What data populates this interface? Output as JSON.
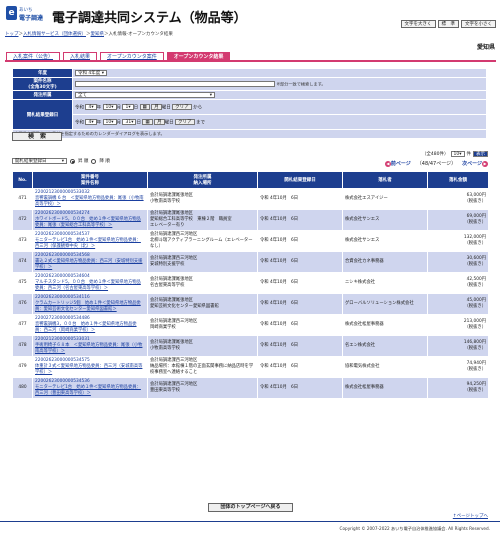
{
  "header": {
    "logo_mark": "e",
    "logo_line1": "あいち",
    "logo_line2": "電子調達",
    "title": "電子調達共同システム（物品等）",
    "font_large": "文字を大きく",
    "font_normal": "標　準",
    "font_small": "文字を小さく"
  },
  "breadcrumb": {
    "items": [
      "トップ",
      "入札情報サービス（団体選択）",
      "愛知県"
    ],
    "current": "入札情報-オープンカウンタ結果",
    "separator": "＞"
  },
  "prefecture": "愛知県",
  "tabs": [
    "入札案件（公告）",
    "入札結果",
    "オープンカウンタ案件",
    "オープンカウンタ結果"
  ],
  "active_tab": 3,
  "form": {
    "year_label": "年度",
    "year_value": "令和 4年度",
    "case_name_label": "案件名称",
    "case_name_sub": "(全角30文字)",
    "case_name_note": "※部分一致で検索します。",
    "dept_label": "発注所属",
    "dept_value": "全て",
    "date_label": "開札結果登録日",
    "era": "令和",
    "from": {
      "y": "4",
      "m": "10",
      "d": "1",
      "yl": "年",
      "ml": "月",
      "dl": "日",
      "wd": "月",
      "wl": "曜日",
      "clear": "クリア",
      "suffix": "から"
    },
    "to": {
      "y": "4",
      "m": "10",
      "d": "31",
      "yl": "年",
      "ml": "月",
      "dl": "日",
      "wd": "月",
      "wl": "曜日",
      "clear": "クリア",
      "suffix": "まで"
    },
    "date_note": "※画像を押下すると日付を指定するためのカレンダーダイアログを表示します。",
    "search_button": "検　索"
  },
  "sort": {
    "field": "開札結果登録日",
    "asc": "昇 順",
    "desc": "降 順"
  },
  "count": {
    "total": "（全480件）",
    "per_page": "10",
    "unit": "件",
    "go": "表示"
  },
  "pager": {
    "prev": "前ページ",
    "page_info": "（48/47ページ）",
    "next": "次ページ"
  },
  "table": {
    "headers": [
      "No.",
      "案件番号\n案件名称",
      "発注所属\n納入場所",
      "開札結果登録日",
      "落札者",
      "落札金額"
    ],
    "rows": [
      {
        "no": "471",
        "id": "22002123000000533032",
        "name": "音響裏調機 6 台　＜愛知県地方物品委員：尾張（小牧南高等学校）＞",
        "dept": "会計局調達課尾張地区",
        "place": "小牧南高等学校",
        "date": "令和 4年10月　6日",
        "winner": "株式会社エスアイジー",
        "amount": "63,000円",
        "tax": "（税抜き）"
      },
      {
        "no": "472",
        "id": "22002623000000534274",
        "name": "ホワイトボード5，００台　始め１件＜愛知県地方物品委員：尾張（愛知総合工科高等学校）＞",
        "dept": "会計局調達課尾張地区",
        "place": "愛知総合工科高等学校　東棟２階　職員室\nエレベーター有り",
        "date": "令和 4年10月　6日",
        "winner": "株式会社サンエス",
        "amount": "69,000円",
        "tax": "（税抜き）"
      },
      {
        "no": "473",
        "id": "22002623000000534537",
        "name": "モニターテレビ1台　始め１件＜愛知県地方物品委員：西三河（保護観察中央（北）＞",
        "dept": "会計局調達課西三河地区",
        "place": "北柳斗瑞アクティブラーニングルーム（エレベーターなし）",
        "date": "令和 4年10月　6日",
        "winner": "株式会社サンエス",
        "amount": "132,000円",
        "tax": "（税抜き）"
      },
      {
        "no": "474",
        "id": "22002623000000534568",
        "name": "書込２式＜愛知県地方物品委員：西三河（安城特別支援学校）＞",
        "dept": "会計局調達課西三河地区",
        "place": "安城特別支援学校",
        "date": "令和 4年10月　6日",
        "winner": "合資会社カネ事務器",
        "amount": "30,600円",
        "tax": "（税抜き）"
      },
      {
        "no": "475",
        "id": "22002623000000534604",
        "name": "マルチスタンド5，００台　始め１件＜愛知県地方物品委員：西三河（名古屋東高等学校）＞",
        "dept": "会計局調達課尾張地区",
        "place": "名古屋東高等学校",
        "date": "令和 4年10月　6日",
        "winner": "ニシキ株式会社",
        "amount": "42,500円",
        "tax": "（税抜き）"
      },
      {
        "no": "476",
        "id": "22002623000000534116",
        "name": "クラムカートリッジ5個　始め１件＜愛知県地方物品委員：愛知芸術文化センター愛知県図書館＞",
        "dept": "会計局調達課尾張地区",
        "place": "愛知芸術文化センター愛知県図書館",
        "date": "令和 4年10月　6日",
        "winner": "グローバルソリューション株式会社",
        "amount": "45,000円",
        "tax": "（税抜き）"
      },
      {
        "no": "477",
        "id": "22002723000000534486",
        "name": "音響裏調機3，００台　始め１件＜愛知県地方物品委員：西三河（岡崎商業学校）＞",
        "dept": "会計局調達課西三河地区",
        "place": "岡崎商業学校",
        "date": "令和 4年10月　6日",
        "winner": "株式会社松屋事務器",
        "amount": "213,000円",
        "tax": "（税抜き）"
      },
      {
        "no": "478",
        "id": "22002123000000533031",
        "name": "手術用椅子６８本　＜愛知県地方物品委員：尾張（小牧南高等学校）＞",
        "dept": "会計局調達課尾張地区",
        "place": "小牧南高等学校",
        "date": "令和 4年10月　6日",
        "winner": "名エン株式会社",
        "amount": "146,800円",
        "tax": "（税抜き）"
      },
      {
        "no": "479",
        "id": "22002623000000534575",
        "name": "体重計３式＜愛知県地方物品委員：西三河（安城南高等学校）＞",
        "dept": "会計局調達課西三河地区",
        "place": "納品場所：本館棟１階の正面玄関事務に納品店時を学校事務室へ連絡すること",
        "date": "令和 4年10月　6日",
        "winner": "協和電気株式会社",
        "amount": "74,940円",
        "tax": "（税抜き）"
      },
      {
        "no": "480",
        "id": "22002623000000534536",
        "name": "モニターテレビ1台　始め１件＜愛知県地方物品委員：西三河（豊田東高等学校）＞",
        "dept": "会計局調達課西三河地区",
        "place": "豊田東高等学校",
        "date": "令和 4年10月　6日",
        "winner": "株式会社松屋事務器",
        "amount": "94,250円",
        "tax": "（税抜き）"
      }
    ]
  },
  "back_button": "団体のトップページへ戻る",
  "page_top": "↑ページトップへ",
  "copyright": "Copyright © 2007-2022 あいち電子自治体推進協議会. All Rights Reserved.",
  "colors": {
    "navy": "#1d3e8f",
    "pink": "#d33a70",
    "row_alt": "#cfd5ee"
  }
}
